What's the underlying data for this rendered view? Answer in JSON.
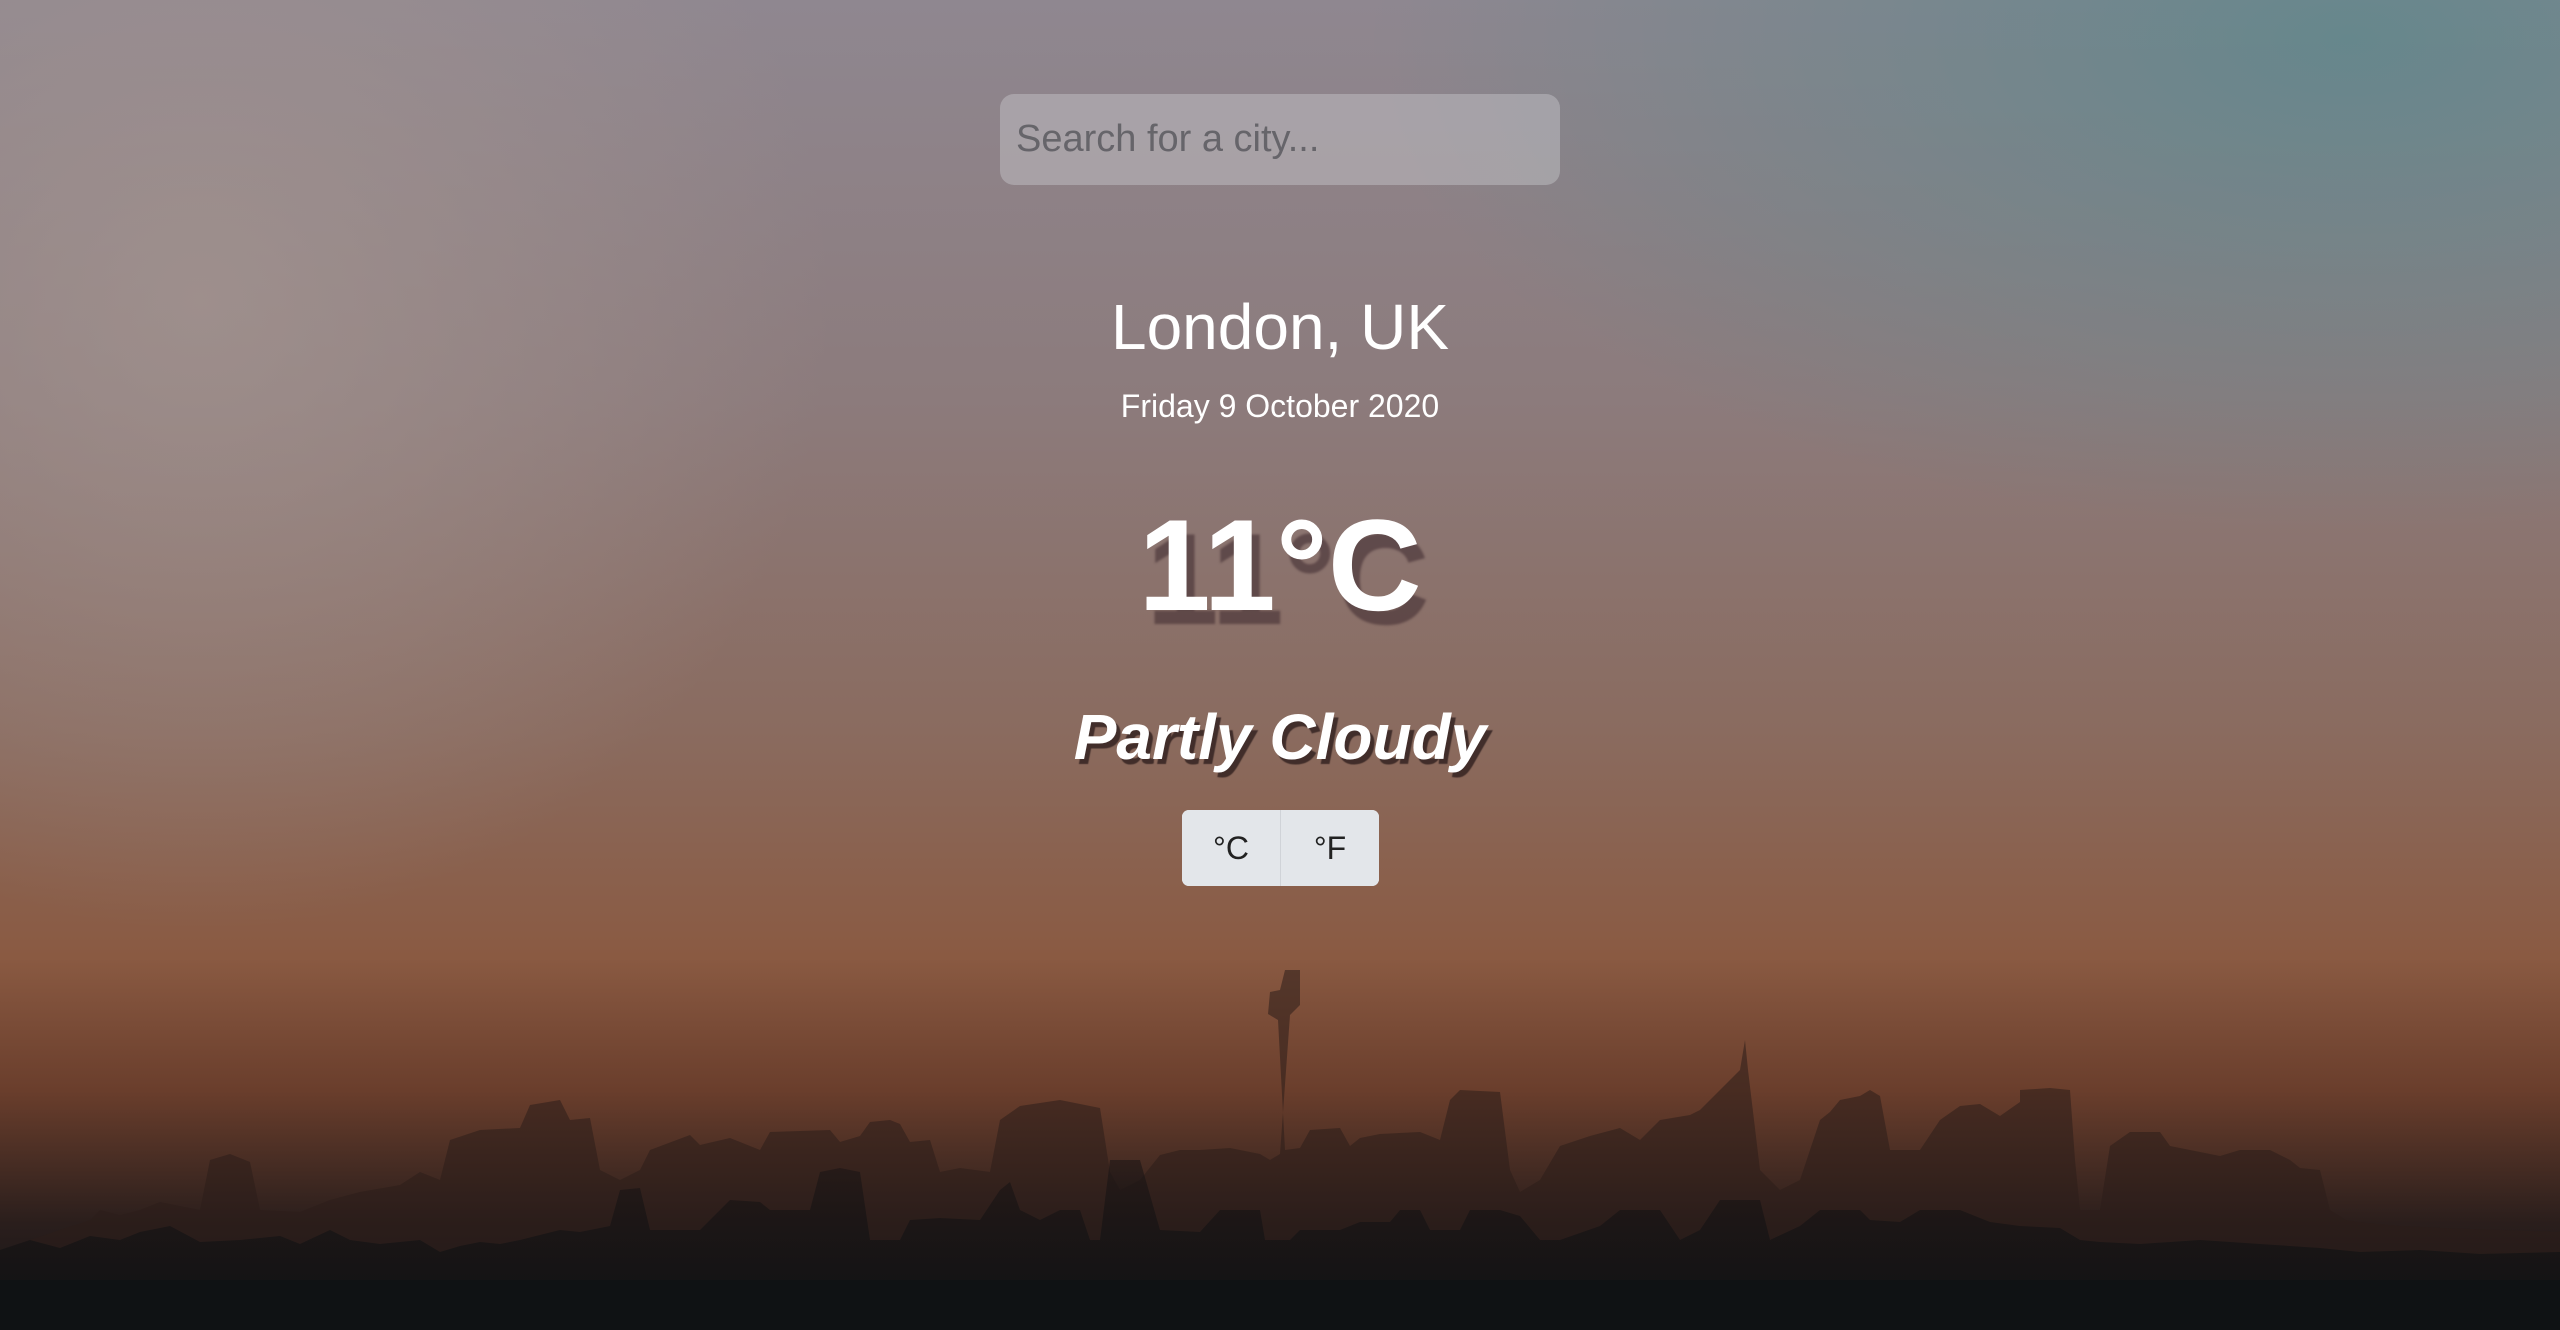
{
  "search": {
    "placeholder": "Search for a city...",
    "value": ""
  },
  "weather": {
    "location": "London, UK",
    "date": "Friday 9 October 2020",
    "temperature": "11°C",
    "condition": "Partly Cloudy"
  },
  "units": {
    "celsius_label": "°C",
    "fahrenheit_label": "°F"
  },
  "background": {
    "description_icon": "city-skyline-image"
  }
}
